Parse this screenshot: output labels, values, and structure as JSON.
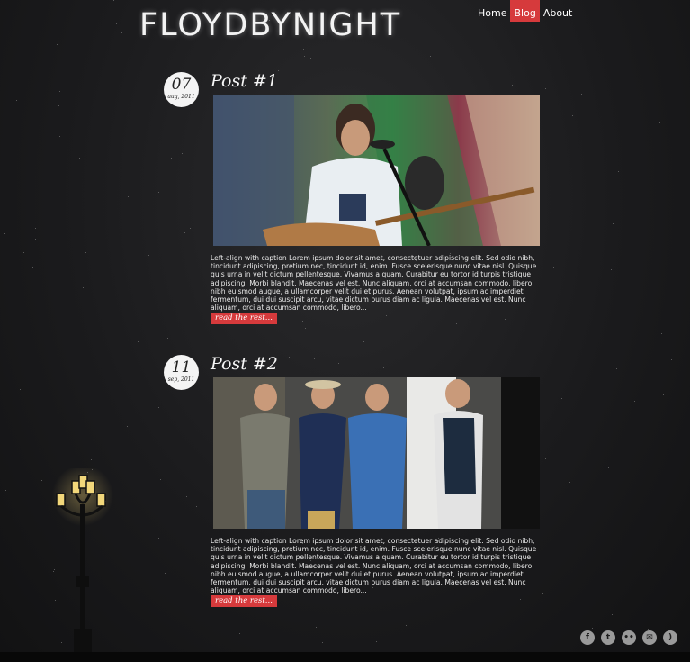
{
  "header": {
    "logo": "FLOYDBYNIGHT",
    "nav": [
      {
        "label": "Home",
        "active": false
      },
      {
        "label": "Blog",
        "active": true
      },
      {
        "label": "About",
        "active": false
      }
    ]
  },
  "posts": [
    {
      "day": "07",
      "month": "aug, 2011",
      "title": "Post #1",
      "image": "performer-with-guitar-photo",
      "text": "Left-align with caption Lorem ipsum dolor sit amet, consectetuer adipiscing elit. Sed odio nibh, tincidunt adipiscing, pretium nec, tincidunt id, enim. Fusce scelerisque nunc vitae nisl. Quisque quis urna in velit dictum pellentesque. Vivamus a quam. Curabitur eu tortor id turpis tristique adipiscing. Morbi blandit. Maecenas vel est. Nunc aliquam, orci at accumsan commodo, libero nibh euismod augue, a ullamcorper velit dui et purus. Aenean volutpat, ipsum ac imperdiet fermentum, dui dui suscipit arcu, vitae dictum purus diam ac ligula. Maecenas vel est. Nunc aliquam, orci at accumsan commodo, libero...",
      "read_more": "read the rest..."
    },
    {
      "day": "11",
      "month": "sep, 2011",
      "title": "Post #2",
      "image": "band-group-photo",
      "text": "Left-align with caption Lorem ipsum dolor sit amet, consectetuer adipiscing elit. Sed odio nibh, tincidunt adipiscing, pretium nec, tincidunt id, enim. Fusce scelerisque nunc vitae nisl. Quisque quis urna in velit dictum pellentesque. Vivamus a quam. Curabitur eu tortor id turpis tristique adipiscing. Morbi blandit. Maecenas vel est. Nunc aliquam, orci at accumsan commodo, libero nibh euismod augue, a ullamcorper velit dui et purus. Aenean volutpat, ipsum ac imperdiet fermentum, dui dui suscipit arcu, vitae dictum purus diam ac ligula. Maecenas vel est. Nunc aliquam, orci at accumsan commodo, libero...",
      "read_more": "read the rest..."
    }
  ],
  "social": [
    {
      "icon": "facebook-icon",
      "glyph": "f"
    },
    {
      "icon": "twitter-icon",
      "glyph": "t"
    },
    {
      "icon": "flickr-icon",
      "glyph": "••"
    },
    {
      "icon": "email-icon",
      "glyph": "✉"
    },
    {
      "icon": "rss-icon",
      "glyph": ")"
    }
  ],
  "colors": {
    "accent": "#d63a3c",
    "background": "#1b1b1d",
    "lamp_glow": "#f5d77a"
  }
}
